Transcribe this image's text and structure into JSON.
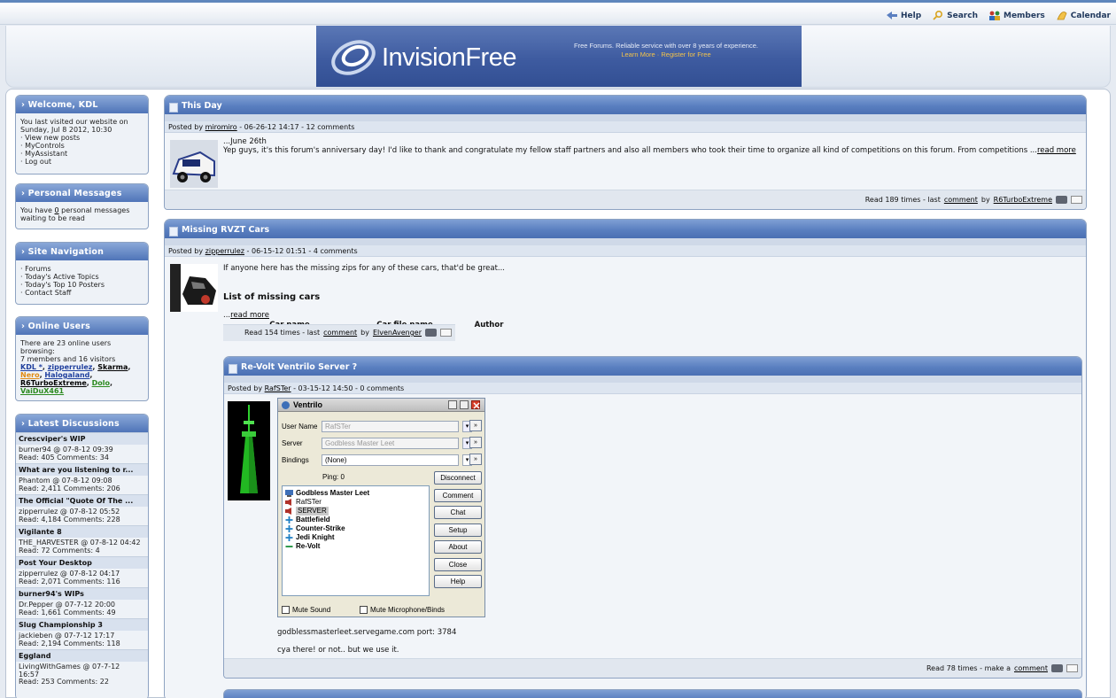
{
  "topnav": {
    "help": "Help",
    "search": "Search",
    "members": "Members",
    "calendar": "Calendar"
  },
  "banner": {
    "logo": "InvisionFree",
    "tagline": "Free Forums. Reliable service with over 8 years of experience.",
    "links": "Learn More · Register for Free"
  },
  "sidebar": {
    "welcome": {
      "title": "Welcome, KDL",
      "line1": "You last visited our website on",
      "line2": "Sunday, Jul 8 2012, 10:30",
      "links": [
        "· View new posts",
        "· MyControls",
        "· MyAssistant",
        "· Log out"
      ]
    },
    "pm": {
      "title": "Personal Messages",
      "pre": "You have ",
      "count": "0",
      "post": " personal messages",
      "line2": "waiting to be read"
    },
    "nav": {
      "title": "Site Navigation",
      "links": [
        "· Forums",
        "· Today's Active Topics",
        "· Today's Top 10 Posters",
        "· Contact Staff"
      ]
    },
    "online": {
      "title": "Online Users",
      "line1": "There are 23 online users",
      "line2": "browsing:",
      "line3": "7 members and 16 visitors",
      "users": [
        {
          "name": "KDL *",
          "color": "#1f3f9e"
        },
        {
          "name": "zipperrulez",
          "color": "#1f3f9e"
        },
        {
          "name": "Skarma",
          "color": "#000000"
        },
        {
          "name": "Nero",
          "color": "#e08a12"
        },
        {
          "name": "Halogaland",
          "color": "#1f3f9e"
        },
        {
          "name": "R6TurboExtreme",
          "color": "#000000"
        },
        {
          "name": "Dolo",
          "color": "#2b8a1e"
        },
        {
          "name": "VaiDuX461",
          "color": "#2b8a1e"
        }
      ]
    },
    "latest": {
      "title": "Latest Discussions",
      "items": [
        {
          "title": "Crescviper's WIP",
          "meta1": "burner94 @ 07-8-12 09:39",
          "meta2": "Read: 405   Comments: 34"
        },
        {
          "title": "What are you listening to r...",
          "meta1": "Phantom @ 07-8-12 09:08",
          "meta2": "Read: 2,411   Comments: 206"
        },
        {
          "title": "The Official \"Quote Of The ...",
          "meta1": "zipperrulez @ 07-8-12 05:52",
          "meta2": "Read: 4,184   Comments: 228"
        },
        {
          "title": "Vigilante 8",
          "meta1": "THE_HARVESTER @ 07-8-12 04:42",
          "meta2": "Read: 72   Comments: 4"
        },
        {
          "title": "Post Your Desktop",
          "meta1": "zipperrulez @ 07-8-12 04:17",
          "meta2": "Read: 2,071   Comments: 116"
        },
        {
          "title": "burner94's WIPs",
          "meta1": "Dr.Pepper @ 07-7-12 20:00",
          "meta2": "Read: 1,661   Comments: 49"
        },
        {
          "title": "Slug Championship 3",
          "meta1": "jackieben @ 07-7-12 17:17",
          "meta2": "Read: 2,194   Comments: 118"
        },
        {
          "title": "Eggland",
          "meta1": "LivingWithGames @ 07-7-12",
          "meta1b": "16:57",
          "meta2": "Read: 253   Comments: 22"
        }
      ]
    }
  },
  "posts": {
    "p1": {
      "title": "This Day",
      "posted_pre": "Posted by ",
      "author": "miromiro",
      "posted_post": " - 06-26-12 14:17 - 12 comments",
      "line1": "...June 26th",
      "body": "Yep guys, it's this forum's anniversary day! I'd like to thank and congratulate my fellow staff partners and also all members who took their time to organize all kind of competitions on this forum. From competitions ...",
      "readmore": "read more",
      "foot_pre": "Read 189 times - last ",
      "foot_link": "comment",
      "foot_by": " by ",
      "foot_user": "R6TurboExtreme"
    },
    "p2": {
      "title": "Missing RVZT Cars",
      "posted_pre": "Posted by ",
      "author": "zipperrulez",
      "posted_post": " - 06-15-12 01:51 - 4 comments",
      "line1": "If anyone here has the missing zips for any of these cars, that'd be great...",
      "heading": "List of missing cars",
      "readmore_pre": "...",
      "readmore": "read more",
      "cols": [
        "Car name",
        "Car file name",
        "Author"
      ],
      "foot_pre": "Read 154 times - last ",
      "foot_link": "comment",
      "foot_by": " by ",
      "foot_user": "ElvenAvenger"
    },
    "p3": {
      "title": "Re-Volt Ventrilo Server ?",
      "posted_pre": "Posted by ",
      "author": "RafSTer",
      "posted_post": " - 03-15-12 14:50 - 0 comments",
      "server_line": "godblessmasterleet.servegame.com port: 3784",
      "closing": "cya there! or not.. but we use it.",
      "foot_pre": "Read 78 times - make a ",
      "foot_link": "comment"
    }
  },
  "ventrilo": {
    "title": "Ventrilo",
    "user_label": "User Name",
    "user_value": "RafSTer",
    "server_label": "Server",
    "server_value": "Godbless Master Leet",
    "bindings_label": "Bindings",
    "bindings_value": "(None)",
    "ping": "Ping: 0",
    "buttons": [
      "Disconnect",
      "Comment",
      "Chat",
      "Setup",
      "About",
      "Close",
      "Help"
    ],
    "tree": [
      {
        "label": "Godbless Master Leet",
        "bold": true,
        "icon": "computer-icon"
      },
      {
        "label": "RafSTer",
        "bold": false,
        "icon": "speaker-icon"
      },
      {
        "label": "SERVER",
        "bold": false,
        "icon": "speaker-icon"
      },
      {
        "label": "Battlefield",
        "bold": true,
        "icon": "channel-plus-icon"
      },
      {
        "label": "Counter-Strike",
        "bold": true,
        "icon": "channel-plus-icon"
      },
      {
        "label": "Jedi Knight",
        "bold": true,
        "icon": "channel-plus-icon"
      },
      {
        "label": "Re-Volt",
        "bold": true,
        "icon": "channel-minus-icon"
      }
    ],
    "mute_sound": "Mute Sound",
    "mute_mic": "Mute Microphone/Binds"
  }
}
